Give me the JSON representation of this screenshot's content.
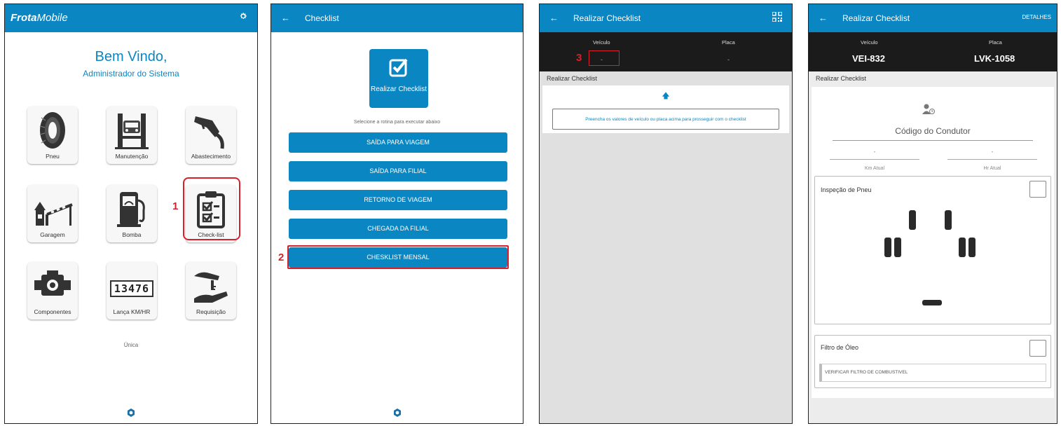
{
  "screen1": {
    "app_name_bold": "Frota",
    "app_name_rest": "Mobile",
    "welcome_title": "Bem Vindo,",
    "welcome_user": "Administrador do Sistema",
    "tiles": [
      {
        "label": "Pneu",
        "icon": "tire-icon"
      },
      {
        "label": "Manutenção",
        "icon": "car-lift-icon"
      },
      {
        "label": "Abastecimento",
        "icon": "fuel-nozzle-icon"
      },
      {
        "label": "Garagem",
        "icon": "garage-gate-icon"
      },
      {
        "label": "Bomba",
        "icon": "fuel-pump-icon"
      },
      {
        "label": "Check-list",
        "icon": "clipboard-check-icon"
      },
      {
        "label": "Componentes",
        "icon": "engine-icon"
      },
      {
        "label": "Lança KM/HR",
        "icon": "odometer-icon"
      },
      {
        "label": "Requisição",
        "icon": "key-hand-icon"
      }
    ],
    "odometer_digits": "13476",
    "footer_text": "Única",
    "callout_number": "1"
  },
  "screen2": {
    "title": "Checklist",
    "main_button_label": "Realizar Checklist",
    "hint": "Selecione a rotina para executar abaixo",
    "options": [
      "SAÍDA PARA VIAGEM",
      "SAÍDA PARA FILIAL",
      "RETORNO DE VIAGEM",
      "CHEGADA DA FILIAL",
      "CHESKLIST MENSAL"
    ],
    "callout_number": "2"
  },
  "screen3": {
    "title": "Realizar Checklist",
    "vehicle_header": "Veículo",
    "plate_header": "Placa",
    "vehicle_value": "-",
    "plate_value": "-",
    "section_title": "Realizar Checklist",
    "info_text": "Preencha os valores de veículo ou placa acima para prosseguir com o checklist",
    "callout_number": "3"
  },
  "screen4": {
    "title": "Realizar Checklist",
    "details_label": "DETALHES",
    "vehicle_header": "Veículo",
    "plate_header": "Placa",
    "vehicle_value": "VEI-832",
    "plate_value": "LVK-1058",
    "section_title": "Realizar Checklist",
    "driver_code_placeholder": "Código do Condutor",
    "km_value": "-",
    "hr_value": "-",
    "km_label": "Km Atual",
    "hr_label": "Hr Atual",
    "tire_inspection_label": "Inspeção de Pneu",
    "oil_filter_label": "Filtro de Óleo",
    "fuel_filter_text": "VERIFICAR FILTRO DE COMBUSTIVEL"
  },
  "colors": {
    "primary": "#0a86c2",
    "highlight": "#d8202a",
    "dark_bar": "#1b1b1b"
  }
}
